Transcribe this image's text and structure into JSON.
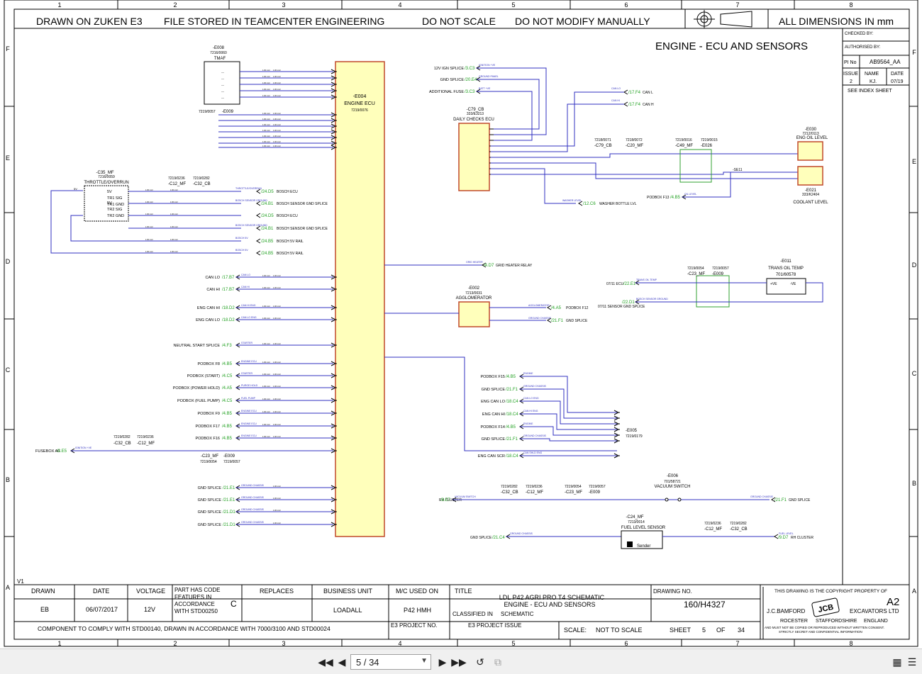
{
  "header": {
    "drawn_on": "DRAWN ON ZUKEN E3",
    "file_stored": "FILE STORED IN TEAMCENTER ENGINEERING",
    "do_not_scale": "DO NOT SCALE",
    "do_not_modify": "DO NOT MODIFY MANUALLY",
    "dimensions": "ALL DIMENSIONS IN mm"
  },
  "grid": {
    "columns": [
      "1",
      "2",
      "3",
      "4",
      "5",
      "6",
      "7",
      "8"
    ],
    "rows": [
      "F",
      "E",
      "D",
      "C",
      "B",
      "A"
    ]
  },
  "sheet_title": "ENGINE - ECU AND SENSORS",
  "revision_block": {
    "checked_by": "CHECKED BY:",
    "authorised_by": "AUTHORISED BY:",
    "pi_no_label": "PI No",
    "pi_no": "AB9564_AA",
    "issue_label": "ISSUE",
    "name_label": "NAME",
    "date_label": "DATE",
    "issue": "2",
    "name": "KJ.",
    "date": "07/19",
    "see_index": "SEE INDEX SHEET"
  },
  "components": {
    "ecu": {
      "ref": "-E004",
      "name": "ENGINE ECU",
      "part": "7219/0076"
    },
    "tmaf": {
      "ref": "-E008",
      "part": "7216/0060",
      "name": "TMAF"
    },
    "e009a": {
      "part": "7219/0057",
      "ref": "-E009"
    },
    "throttle": {
      "ref": "-C35_MF",
      "part": "7216/0059",
      "name": "THROTTLE/OVERRUN"
    },
    "c12": {
      "part": "7219/0236",
      "ref": "-C12_MF"
    },
    "c32": {
      "part": "7219/0282",
      "ref": "-C32_CB"
    },
    "daily": {
      "ref": "-C79_CB",
      "part": "333/E3213",
      "name": "DAILY CHECKS ECU"
    },
    "e030": {
      "ref": "-E030",
      "part": "7212/0113",
      "name": "ENG OIL LEVEL"
    },
    "e021": {
      "ref": "-E021",
      "part": "333/K2404",
      "name": "COOLANT LEVEL"
    },
    "e011": {
      "ref": "-E011",
      "name": "TRANS OIL TEMP",
      "part": "701/60578"
    },
    "agg": {
      "ref": "-E002",
      "part": "7213/0031",
      "name": "AGGLOMERATOR"
    },
    "e005": {
      "ref": "-E005",
      "part": "7219/0179"
    },
    "e006": {
      "ref": "-E006",
      "part": "701/58721",
      "name": "VACUUM SWITCH"
    },
    "fuel": {
      "ref": "-C24_MF",
      "part": "7213/0014",
      "name": "FUEL LEVEL SENSOR",
      "sender": "Sender"
    }
  },
  "left_signals": [
    {
      "label": "CAN LO",
      "ref": "/17.B7",
      "wire": "CAN LO"
    },
    {
      "label": "CAN HI",
      "ref": "/17.B7",
      "wire": "CAN HI"
    },
    {
      "label": "ENG CAN HI",
      "ref": "/18.D2",
      "wire": "CAN HI ENG"
    },
    {
      "label": "ENG CAN LO",
      "ref": "/18.D2",
      "wire": "CAN LO ENG"
    },
    {
      "label": "NEUTRAL START SPLICE",
      "ref": "/4.F3",
      "wire": "STARTER"
    },
    {
      "label": "PODBOX F8",
      "ref": "/4.B5",
      "wire": "ENGINE ECU"
    },
    {
      "label": "PODBOX (START)",
      "ref": "/4.C5",
      "wire": "STARTER"
    },
    {
      "label": "PODBOX (POWER HOLD)",
      "ref": "/4.A5",
      "wire": "PURGE HOLD"
    },
    {
      "label": "PODBOX (FUEL PUMP)",
      "ref": "/4.C5",
      "wire": "FUEL PUMP"
    },
    {
      "label": "PODBOX F9",
      "ref": "/4.B5",
      "wire": "ENGINE ECU"
    },
    {
      "label": "PODBOX F17",
      "ref": "/4.B5",
      "wire": "ENGINE ECU"
    },
    {
      "label": "PODBOX F16",
      "ref": "/4.B5",
      "wire": "ENGINE ECU"
    }
  ],
  "gnd_signals": [
    {
      "label": "GND SPLICE",
      "ref": "/21.E1",
      "wire": "GROUND CHASSIS"
    },
    {
      "label": "GND SPLICE",
      "ref": "/21.E1",
      "wire": "GROUND CHASSIS"
    },
    {
      "label": "GND SPLICE",
      "ref": "/21.D1",
      "wire": "GROUND CHASSIS"
    },
    {
      "label": "GND SPLICE",
      "ref": "/21.D1",
      "wire": "GROUND CHASSIS"
    }
  ],
  "throttle_refs": [
    {
      "ref": "/24.D5",
      "text": "BOSCH ECU",
      "wire": "THROTTLE/OVERRUN"
    },
    {
      "ref": "/24.B1",
      "text": "BOSCH SENSOR GND SPLICE",
      "wire": "BOSCH SENSOR GROUND"
    },
    {
      "ref": "/24.D5",
      "text": "BOSCH ECU",
      "wire": ""
    },
    {
      "ref": "/24.B1",
      "text": "BOSCH SENSOR GND SPLICE",
      "wire": "BOSCH SENSOR GROUND"
    },
    {
      "ref": "/24.B5",
      "text": "BOSCH 5V RAIL",
      "wire": "BOSCH 5V"
    },
    {
      "ref": "/24.B5",
      "text": "BOSCH 5V RAIL",
      "wire": "BOSCH 5V"
    }
  ],
  "throttle_pins": [
    "5V",
    "TR1 SIG",
    "TR1 GND",
    "5V",
    "TR2 SIG",
    "TR2 GND"
  ],
  "daily_inputs": [
    {
      "label": "12V IGN SPLICE",
      "ref": "/3.C3",
      "wire": "IGNITION +VE"
    },
    {
      "label": "GND SPLICE",
      "ref": "/20.E4",
      "wire": "GROUND PANEL"
    },
    {
      "label": "ADDITIONAL FUSE",
      "ref": "/3.C3",
      "wire": "BATT +VE"
    }
  ],
  "can_out": [
    {
      "ref": "/17.F4",
      "text": "CAN L",
      "wire": "CAN LO"
    },
    {
      "ref": "/17.F4",
      "text": "CAN H",
      "wire": "CAN HI"
    }
  ],
  "connectors_top": [
    {
      "part": "7218/0071",
      "ref": "-C79_CB"
    },
    {
      "part": "7218/0072",
      "ref": "-C20_MF"
    },
    {
      "part": "7219/0016",
      "ref": "-C49_MF"
    },
    {
      "part": "7219/0015",
      "ref": "-E026"
    }
  ],
  "se11": "-SE11",
  "podbox_f13": {
    "label": "PODBOX F13",
    "ref": "/4.B5",
    "wire": "OIL LEVEL"
  },
  "washer": {
    "ref": "/12.C6",
    "text": "WASHER BOTTLE LVL",
    "wire": "WASHER LEVEL"
  },
  "grid_heater": {
    "ref": "/4.D7",
    "text": "GRID HEATER RELAY",
    "wire": "GRID HEATER"
  },
  "agg_refs": [
    {
      "ref": "/4.A5",
      "text": "PODBOX F12",
      "wire": "AGGLOMERATOR"
    },
    {
      "ref": "/21.F1",
      "text": "GND SPLICE",
      "wire": "GROUND CHASSIS"
    }
  ],
  "trans": {
    "c23": {
      "part": "7219/0054",
      "ref": "-C23_MF"
    },
    "e009": {
      "part": "7219/0057",
      "ref": "-E009"
    },
    "in1": {
      "label": "07/11 ECU",
      "ref": "/22.E1",
      "wire": "TRANS OIL TEMP"
    },
    "in2": {
      "label": "07/11 SENSOR GND SPLICE",
      "ref": "/22.D1",
      "wire": "BOSCH SENSOR GROUND"
    },
    "pins": [
      "+VE",
      "-VE"
    ]
  },
  "e005_inputs": [
    {
      "label": "PODBOX F15",
      "ref": "/4.B5",
      "wire": "ENGINE"
    },
    {
      "label": "GND SPLICE",
      "ref": "/21.F1",
      "wire": "GROUND CHASSIS"
    },
    {
      "label": "ENG CAN LO",
      "ref": "/18.C4",
      "wire": "CAN LO ENG"
    },
    {
      "label": "ENG CAN HI",
      "ref": "/18.C4",
      "wire": "CAN HI ENG"
    },
    {
      "label": "PODBOX F14",
      "ref": "/4.B5",
      "wire": "ENGINE"
    },
    {
      "label": "GND SPLICE",
      "ref": "/21.F1",
      "wire": "GROUND CHASSIS"
    },
    {
      "label": "ENG CAN SCR",
      "ref": "/18.C4",
      "wire": "CAN SHLD ENG"
    }
  ],
  "fusebox": {
    "label": "FUSEBOX A6",
    "ref": "/3.E5",
    "wire": "IGNITION +VE"
  },
  "left_conn": {
    "c32": {
      "part": "7219/0282",
      "ref": "-C32_CB"
    },
    "c12": {
      "part": "7219/0236",
      "ref": "-C12_MF"
    },
    "c23": {
      "part": "7219/0054",
      "ref": "-C23_MF"
    },
    "e009": {
      "part": "7219/0057",
      "ref": "-E009"
    }
  },
  "vacuum_row": {
    "rh": {
      "label": "RH CLUSTER",
      "ref": "/9.E7",
      "wire": "VACUUM SWITCH"
    },
    "gnd": {
      "ref": "/21.F1",
      "text": "GND SPLICE",
      "wire": "GROUND CHASSIS"
    },
    "conns": [
      {
        "part": "7219/0282",
        "ref": "-C32_CB"
      },
      {
        "part": "7219/0236",
        "ref": "-C12_MF"
      },
      {
        "part": "7219/0054",
        "ref": "-C23_MF"
      },
      {
        "part": "7219/0057",
        "ref": "-E009"
      }
    ]
  },
  "fuel_row": {
    "gnd": {
      "label": "GND SPLICE",
      "ref": "/21.C4",
      "wire": "GROUND CHASSIS"
    },
    "out": {
      "ref": "/9.D7",
      "text": "RH CLUSTER",
      "wire": "FUEL LEVEL"
    },
    "c12": {
      "part": "7219/0236",
      "ref": "-C12_MF"
    },
    "c32": {
      "part": "7219/0282",
      "ref": "-C32_CB"
    }
  },
  "version_mark": "V1",
  "title_block": {
    "drawn_label": "DRAWN",
    "date_label": "DATE",
    "voltage_label": "VOLTAGE",
    "part_code": "PART HAS CODE FEATURES IN ACCORDANCE WITH STD00250",
    "part_code_class": "C",
    "replaces_label": "REPLACES",
    "business_unit_label": "BUSINESS UNIT",
    "mc_used_label": "M/C USED ON",
    "title_label": "TITLE",
    "drawn": "EB",
    "date": "06/07/2017",
    "voltage": "12V",
    "business_unit": "LOADALL",
    "mc_used": "P42 HMH",
    "title_line1": "LDL P42 AGRI PRO T4 SCHEMATIC",
    "title_line2": "ENGINE - ECU AND SENSORS",
    "classified_label": "CLASSIFIED IN",
    "classified": "SCHEMATIC",
    "component_note": "COMPONENT TO COMPLY WITH STD00140, DRAWN IN ACCORDANCE WITH 7000/3100 AND STD00024",
    "e3_project": "E3 PROJECT NO.",
    "e3_issue": "E3 PROJECT ISSUE",
    "scale_label": "SCALE:",
    "scale": "NOT TO SCALE",
    "drawing_no_label": "DRAWING NO.",
    "drawing_no": "160/H4327",
    "sheet_label": "SHEET",
    "sheet": "5",
    "of_label": "OF",
    "of": "34",
    "copyright": "THIS DRAWING IS THE COPYRIGHT PROPERTY OF",
    "size": "A2",
    "company_left": "J.C.BAMFORD",
    "company_right": "EXCAVATORS LTD",
    "logo": "JCB",
    "addr1": "ROCESTER",
    "addr2": "STAFFORDSHIRE",
    "addr3": "ENGLAND",
    "legal1": "AND MUST NOT BE COPIED OR REPRODUCED WITHOUT WRITTEN CONSENT.",
    "legal2": "STRICTLY SECRET AND CONFIDENTIAL INFORMATION"
  },
  "toolbar": {
    "page_display": "5 / 34",
    "first_icon": "first-page-icon",
    "prev_icon": "prev-page-icon",
    "next_icon": "next-page-icon",
    "last_icon": "last-page-icon",
    "rotate_icon": "rotate-icon",
    "fit_icon": "fit-page-icon",
    "view_icon": "single-page-view-icon",
    "menu_icon": "menu-icon"
  },
  "colors": {
    "ecu_fill": "#ffffbb",
    "ecu_border": "#c0482a",
    "wire": "#3030c0",
    "ref_green": "#20a020",
    "box_green": "#30a030"
  }
}
